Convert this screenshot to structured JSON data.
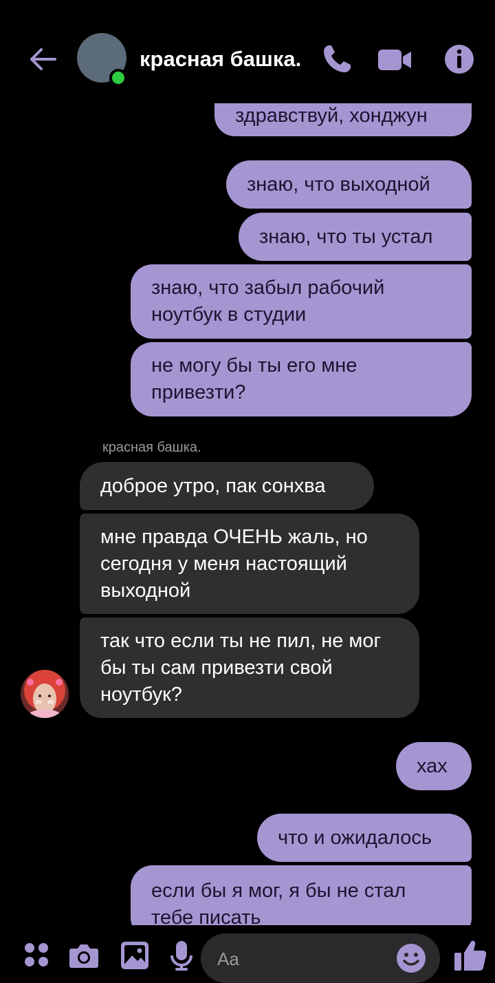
{
  "header": {
    "contact_name": "красная башка.",
    "icons": {
      "back": "arrow-left-icon",
      "phone": "phone-icon",
      "video": "video-camera-icon",
      "info": "info-icon"
    },
    "online": true
  },
  "colors": {
    "accent": "#a596d2",
    "outgoing_bubble": "#a596d2",
    "incoming_bubble": "#2f2f31",
    "online_dot": "#2ecc40",
    "background": "#000000"
  },
  "messages": {
    "m1": "здравствуй, хонджун",
    "m2": "знаю, что выходной",
    "m3": "знаю, что ты устал",
    "m4": "знаю, что забыл рабочий ноутбук в студии",
    "m5": "не могу бы ты его мне привезти?",
    "sender": "красная башка.",
    "r1": "доброе утро, пак сонхва",
    "r2": "мне правда ОЧЕНЬ жаль, но сегодня у меня настоящий выходной",
    "r3": "так что если ты не пил, не мог бы ты сам привезти свой ноутбук?",
    "m6": "хах",
    "m7": "что и ожидалось",
    "m8": "если бы я мог, я бы не стал тебе писать"
  },
  "composer": {
    "placeholder": "Aa",
    "icons": [
      "apps-icon",
      "camera-icon",
      "gallery-icon",
      "microphone-icon",
      "emoji-icon",
      "thumbs-up-icon"
    ]
  }
}
